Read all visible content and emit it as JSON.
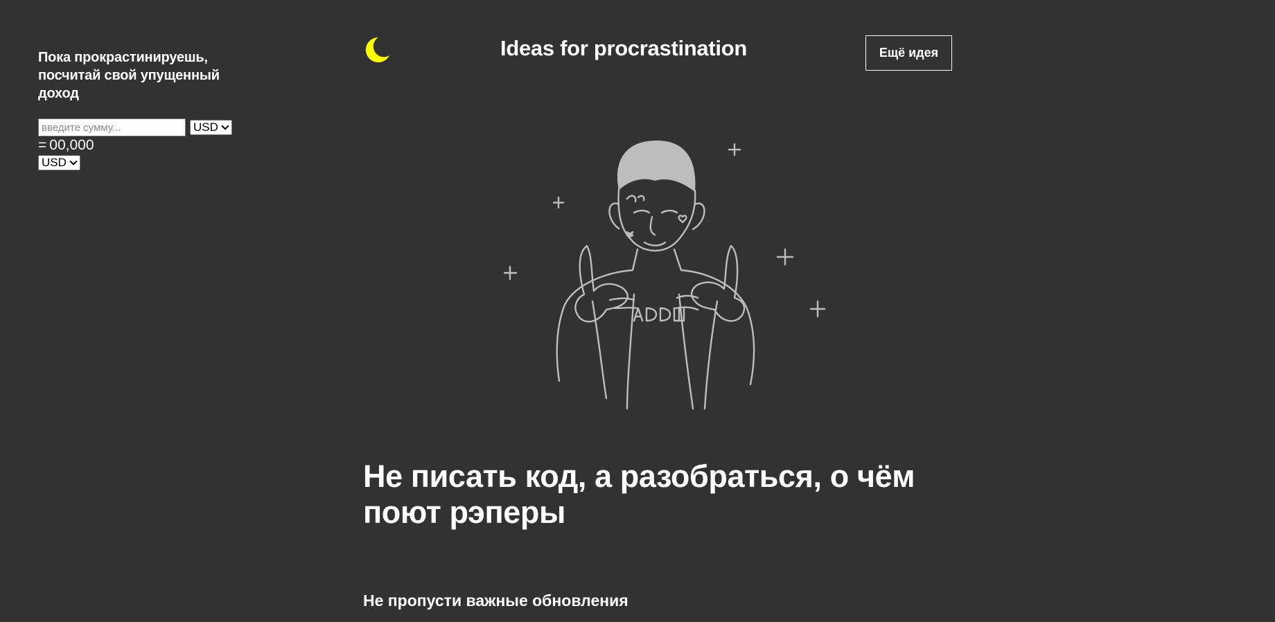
{
  "calculator": {
    "title": "Пока прокрастинируешь, посчитай свой упущенный доход",
    "amount_placeholder": "введите сумму...",
    "amount_value": "",
    "from_currency": "USD",
    "result_prefix": "=",
    "result_value": "00,000",
    "to_currency": "USD"
  },
  "header": {
    "theme_icon": "moon-icon",
    "theme_icon_color": "#FFFF00",
    "title": "Ideas for procrastination",
    "more_button_label": "Ещё идея"
  },
  "idea": {
    "illustration": "rapper-illustration",
    "text": "Не писать код, а разобраться, о чём поют рэперы"
  },
  "updates": {
    "heading": "Не пропусти важные обновления"
  },
  "colors": {
    "background": "#323232",
    "text": "#FFFFFF",
    "illustration_stroke": "#BDBDBD"
  }
}
